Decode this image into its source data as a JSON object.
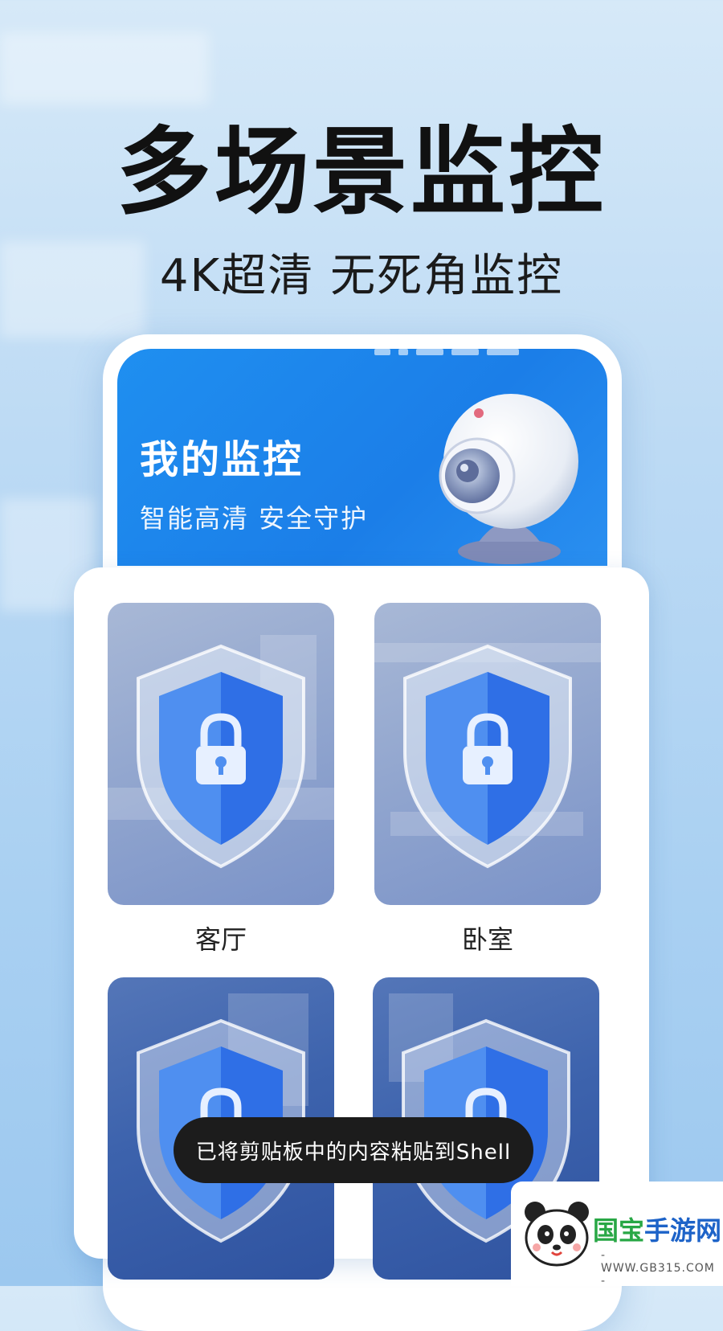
{
  "promo": {
    "headline": "多场景监控",
    "subline": "4K超清 无死角监控"
  },
  "app_screen": {
    "title": "我的监控",
    "subtitle": "智能高清 安全守护",
    "camera_icon": "webcam-icon"
  },
  "rooms": [
    {
      "label": "客厅",
      "icon": "shield-lock-icon"
    },
    {
      "label": "卧室",
      "icon": "shield-lock-icon"
    },
    {
      "label": "",
      "icon": "shield-lock-icon"
    },
    {
      "label": "",
      "icon": "shield-lock-icon"
    }
  ],
  "toast": {
    "message": "已将剪贴板中的内容粘贴到Shell"
  },
  "watermark": {
    "brand_part1": "国宝",
    "brand_part2": "手游网",
    "url": "- WWW.GB315.COM -"
  },
  "colors": {
    "brand_blue": "#1f8ff0",
    "background": "#bcdaf4",
    "toast_bg": "#1c1c1c"
  }
}
